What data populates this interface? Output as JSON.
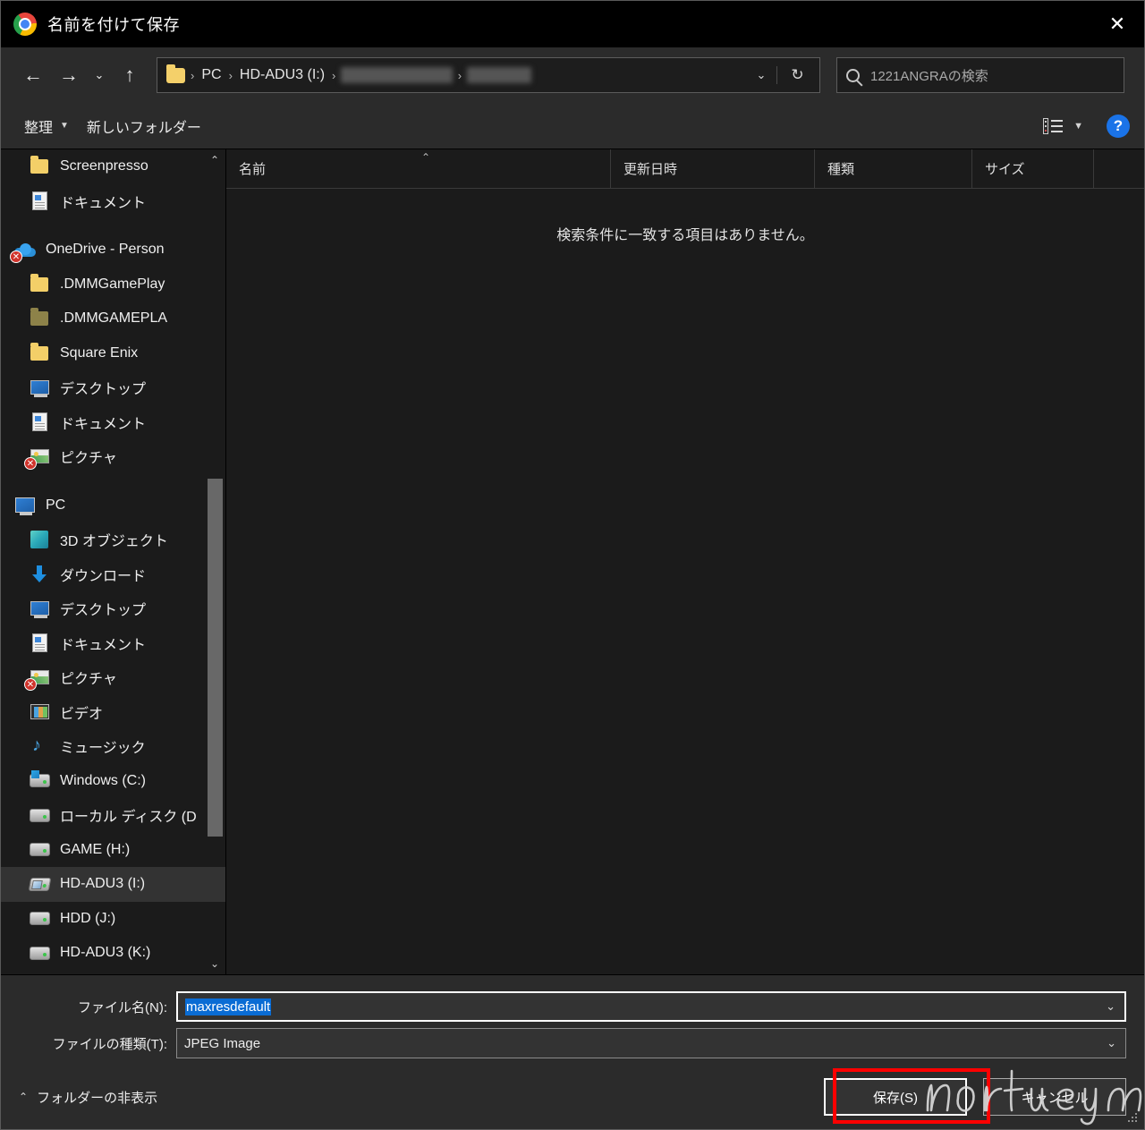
{
  "window": {
    "title": "名前を付けて保存",
    "app_icon": "chrome-icon",
    "close_label": "✕"
  },
  "navbar": {
    "back_icon": "←",
    "forward_icon": "→",
    "recent_icon": "⌄",
    "up_icon": "↑",
    "breadcrumb": [
      {
        "label": "PC",
        "blurred": false
      },
      {
        "label": "HD-ADU3 (I:)",
        "blurred": false
      },
      {
        "label": "■■■■■■■ ■■■■■",
        "blurred": true
      },
      {
        "label": "■■■■■■■",
        "blurred": true
      }
    ],
    "dropdown_icon": "⌄",
    "refresh_icon": "↻",
    "search": {
      "placeholder": "1221ANGRAの検索",
      "icon": "search-icon",
      "value": ""
    }
  },
  "commandbar": {
    "organize_label": "整理",
    "organize_caret": "▼",
    "new_folder_label": "新しいフォルダー",
    "view_icon": "list-view-icon",
    "view_caret": "▼",
    "help_label": "?"
  },
  "sidebar": {
    "items": [
      {
        "label": "Screenpresso",
        "icon": "folder-icon",
        "indent": 1,
        "selected": false
      },
      {
        "label": "ドキュメント",
        "icon": "document-icon",
        "indent": 1,
        "selected": false
      },
      {
        "label": "",
        "icon": "spacer",
        "indent": 0,
        "selected": false
      },
      {
        "label": "OneDrive - Person",
        "icon": "onedrive-icon",
        "indent": 0,
        "selected": false,
        "error": true
      },
      {
        "label": ".DMMGamePlay",
        "icon": "folder-icon",
        "indent": 1,
        "selected": false
      },
      {
        "label": ".DMMGAMEPLA",
        "icon": "folder-dim-icon",
        "indent": 1,
        "selected": false
      },
      {
        "label": "Square Enix",
        "icon": "folder-icon",
        "indent": 1,
        "selected": false
      },
      {
        "label": "デスクトップ",
        "icon": "desktop-icon",
        "indent": 1,
        "selected": false
      },
      {
        "label": "ドキュメント",
        "icon": "document-icon",
        "indent": 1,
        "selected": false
      },
      {
        "label": "ピクチャ",
        "icon": "pictures-icon",
        "indent": 1,
        "selected": false,
        "error": true
      },
      {
        "label": "",
        "icon": "spacer",
        "indent": 0,
        "selected": false
      },
      {
        "label": "PC",
        "icon": "pc-icon",
        "indent": 0,
        "selected": false
      },
      {
        "label": "3D オブジェクト",
        "icon": "cube-icon",
        "indent": 1,
        "selected": false
      },
      {
        "label": "ダウンロード",
        "icon": "download-icon",
        "indent": 1,
        "selected": false
      },
      {
        "label": "デスクトップ",
        "icon": "desktop-icon",
        "indent": 1,
        "selected": false
      },
      {
        "label": "ドキュメント",
        "icon": "document-icon",
        "indent": 1,
        "selected": false
      },
      {
        "label": "ピクチャ",
        "icon": "pictures-icon",
        "indent": 1,
        "selected": false,
        "error": true
      },
      {
        "label": "ビデオ",
        "icon": "video-icon",
        "indent": 1,
        "selected": false
      },
      {
        "label": "ミュージック",
        "icon": "music-icon",
        "indent": 1,
        "selected": false
      },
      {
        "label": "Windows (C:)",
        "icon": "drive-windows-icon",
        "indent": 1,
        "selected": false
      },
      {
        "label": "ローカル ディスク (D",
        "icon": "drive-icon",
        "indent": 1,
        "selected": false
      },
      {
        "label": "GAME (H:)",
        "icon": "drive-icon",
        "indent": 1,
        "selected": false
      },
      {
        "label": "HD-ADU3 (I:)",
        "icon": "drive-external-icon",
        "indent": 1,
        "selected": true
      },
      {
        "label": "HDD (J:)",
        "icon": "drive-icon",
        "indent": 1,
        "selected": false
      },
      {
        "label": "HD-ADU3 (K:)",
        "icon": "drive-icon",
        "indent": 1,
        "selected": false
      }
    ],
    "scroll_up_icon": "⌃",
    "scroll_down_icon": "⌄"
  },
  "filelist": {
    "columns": [
      {
        "label": "名前",
        "sorted": true,
        "sort_icon": "⌃"
      },
      {
        "label": "更新日時",
        "sorted": false
      },
      {
        "label": "種類",
        "sorted": false
      },
      {
        "label": "サイズ",
        "sorted": false
      }
    ],
    "empty_message": "検索条件に一致する項目はありません。",
    "rows": []
  },
  "footer": {
    "filename_label": "ファイル名(N):",
    "filename_value": "maxresdefault",
    "filename_selected": true,
    "filetype_label": "ファイルの種類(T):",
    "filetype_value": "JPEG Image",
    "dropdown_icon": "⌄",
    "hide_folders_label": "フォルダーの非表示",
    "hide_folders_caret": "⌃",
    "save_button": "保存(S)",
    "cancel_button": "キャンセル"
  },
  "annotations": {
    "highlight_color": "#ff0000",
    "watermark_text": "noriteyu"
  }
}
